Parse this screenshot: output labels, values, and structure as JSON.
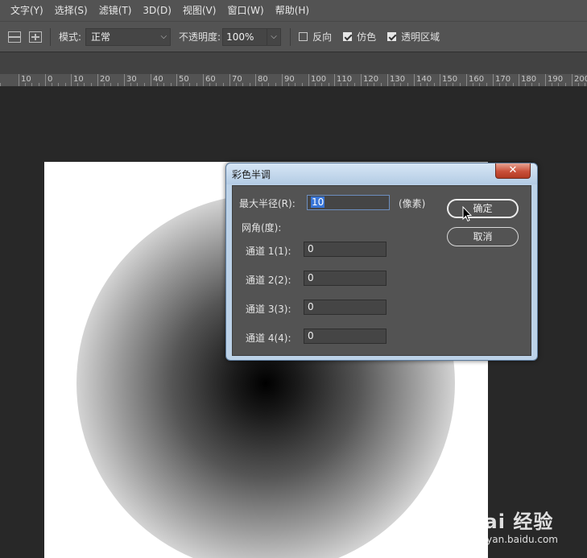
{
  "menu": [
    "文字(Y)",
    "选择(S)",
    "滤镜(T)",
    "3D(D)",
    "视图(V)",
    "窗口(W)",
    "帮助(H)"
  ],
  "options": {
    "mode_label": "模式:",
    "mode_value": "正常",
    "opacity_label": "不透明度:",
    "opacity_value": "100%",
    "reverse_label": "反向",
    "reverse_checked": false,
    "dither_label": "仿色",
    "dither_checked": true,
    "transparency_label": "透明区域",
    "transparency_checked": true
  },
  "ruler": {
    "labels": [
      "10",
      "0",
      "10",
      "20",
      "30",
      "40",
      "50",
      "60",
      "70",
      "80",
      "90",
      "100",
      "110",
      "120",
      "130",
      "140",
      "150",
      "160",
      "170",
      "180",
      "190",
      "200"
    ]
  },
  "dialog": {
    "title": "彩色半调",
    "close_glyph": "✕",
    "max_radius_label": "最大半径(R):",
    "max_radius_value": "10",
    "unit_label": "(像素)",
    "screen_angles_label": "网角(度):",
    "channels": [
      {
        "label": "通道 1(1):",
        "value": "0"
      },
      {
        "label": "通道 2(2):",
        "value": "0"
      },
      {
        "label": "通道 3(3):",
        "value": "0"
      },
      {
        "label": "通道 4(4):",
        "value": "0"
      }
    ],
    "ok_label": "确定",
    "cancel_label": "取消"
  },
  "watermark": {
    "line1": "Bai 经验",
    "line2": "jingyan.baidu.com"
  },
  "colors": {
    "panel": "#535353",
    "workspace": "#282828",
    "dialog_frame": "#bcd2e8",
    "close_red": "#c9503a",
    "selection_blue": "#3875d7"
  }
}
